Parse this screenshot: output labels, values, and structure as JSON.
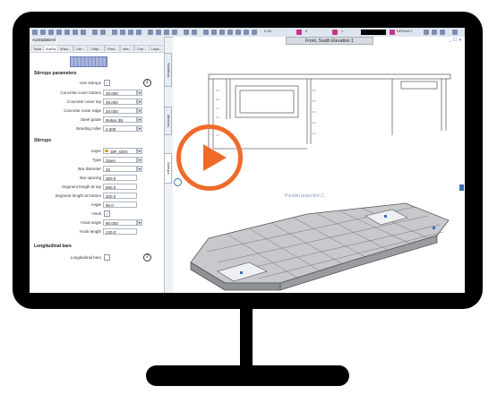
{
  "toolbar": {
    "scale_text": "0.25",
    "layer_text": "0",
    "font_text": "1",
    "style_text": "DEFAULT"
  },
  "panel": {
    "title": "AutStabBeml",
    "tabs": [
      "Tools",
      "AutStc",
      "Wiza...",
      "Libr...",
      "Obje...",
      "Plan...",
      "Inte...",
      "Con...",
      "Laye..."
    ],
    "stirrups_params_title": "Stirrups parameters",
    "use_stirrups_label": "Use stirrups",
    "use_stirrups_badge": "1",
    "params": [
      {
        "label": "Concrete cover bottom",
        "value": "25.000"
      },
      {
        "label": "Concrete cover top",
        "value": "25.000"
      },
      {
        "label": "Concrete cover edge",
        "value": "20.000"
      },
      {
        "label": "Steel grade",
        "value": "Rebar (B)"
      },
      {
        "label": "Bending roller",
        "value": "4.000"
      }
    ],
    "stirrups_title": "Stirrups",
    "stirrups": [
      {
        "label": "Layer",
        "value": "BR_GEN"
      },
      {
        "label": "Type",
        "value": "Open"
      },
      {
        "label": "Bar diameter",
        "value": "10"
      },
      {
        "label": "Bar spacing",
        "value": "300.0"
      },
      {
        "label": "Segment length at top",
        "value": "600.0"
      },
      {
        "label": "Segment length at bottom",
        "value": "400.0"
      },
      {
        "label": "Angle",
        "value": "90.0"
      },
      {
        "label": "Hook",
        "value": ""
      },
      {
        "label": "Hook angle",
        "value": "90.000"
      },
      {
        "label": "Hook length",
        "value": "130.0"
      }
    ],
    "long_title": "Longitudinal bars",
    "long_label": "Longitudinal bars",
    "long_badge": "2"
  },
  "vtabs": [
    "Workflow",
    "Meshes",
    "Stirrups"
  ],
  "viewport": {
    "title": "Front, South Elevation 1",
    "projection_label": "Parallel projection 2",
    "window_buttons": "_ ☐ ✕"
  },
  "colors": {
    "play_accent": "#f06a2a",
    "monitor": "#000000",
    "selection_blue": "#6f7fb4"
  }
}
